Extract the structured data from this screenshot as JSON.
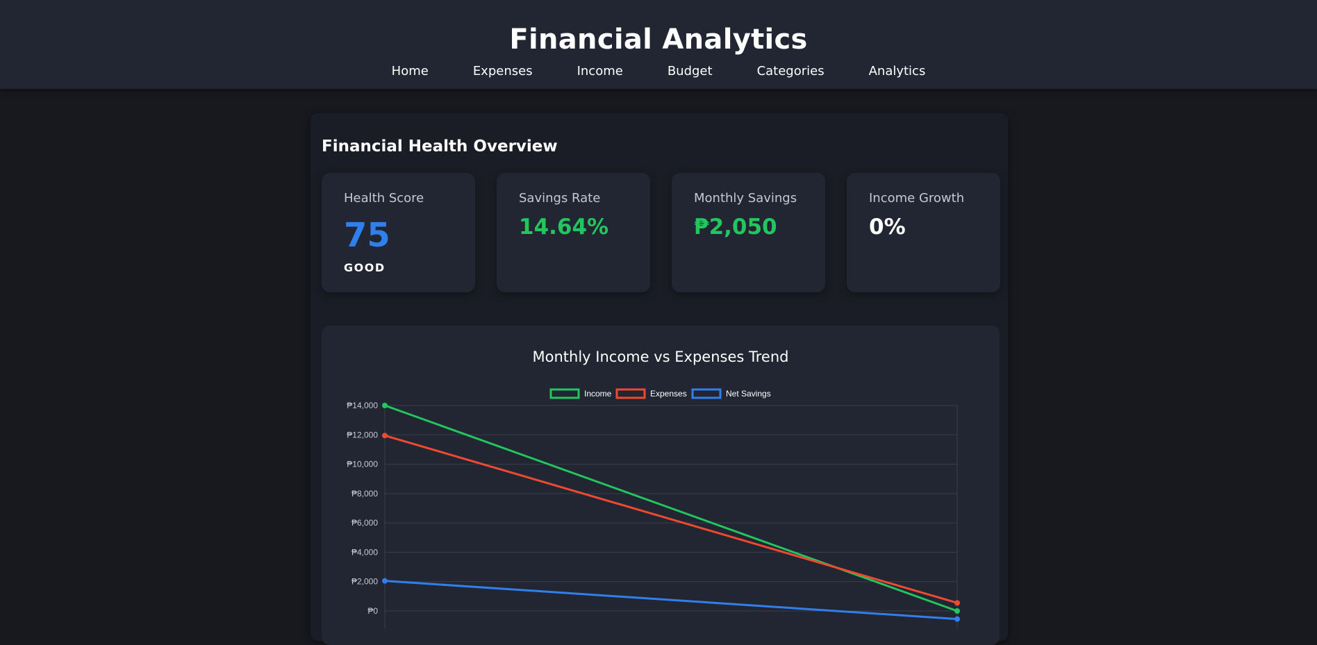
{
  "header": {
    "title": "Financial Analytics",
    "nav": [
      "Home",
      "Expenses",
      "Income",
      "Budget",
      "Categories",
      "Analytics"
    ]
  },
  "overview": {
    "title": "Financial Health Overview",
    "cards": [
      {
        "label": "Health Score",
        "value": "75",
        "sub": "GOOD",
        "color": "#2f80ed"
      },
      {
        "label": "Savings Rate",
        "value": "14.64%",
        "sub": "",
        "color": "#22c55e"
      },
      {
        "label": "Monthly Savings",
        "value": "₱2,050",
        "sub": "",
        "color": "#22c55e"
      },
      {
        "label": "Income Growth",
        "value": "0%",
        "sub": "",
        "color": "#ffffff"
      }
    ]
  },
  "colors": {
    "accent_blue": "#2f80ed",
    "positive_green": "#22c55e",
    "expense_red": "#ef4a2f"
  },
  "chart_data": {
    "type": "line",
    "title": "Monthly Income vs Expenses Trend",
    "y_tick_labels": [
      "₱14,000",
      "₱12,000",
      "₱10,000",
      "₱8,000",
      "₱6,000",
      "₱4,000",
      "₱2,000",
      "₱0"
    ],
    "y_ticks": [
      14000,
      12000,
      10000,
      8000,
      6000,
      4000,
      2000,
      0
    ],
    "ylim": [
      0,
      14000
    ],
    "x_count": 2,
    "legend_position": "top-center",
    "grid": true,
    "series": [
      {
        "name": "Income",
        "color": "#22c55e",
        "values": [
          14000,
          0
        ]
      },
      {
        "name": "Expenses",
        "color": "#ef4a2f",
        "values": [
          11950,
          550
        ]
      },
      {
        "name": "Net Savings",
        "color": "#2f80ed",
        "values": [
          2050,
          -550
        ]
      }
    ]
  }
}
